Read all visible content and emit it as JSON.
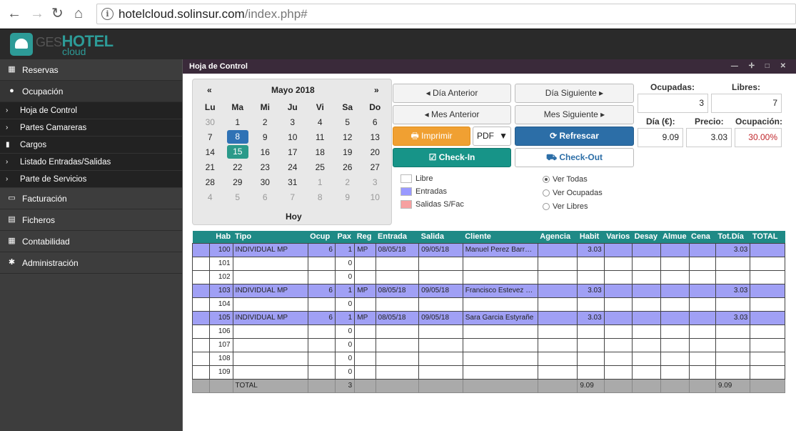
{
  "browser": {
    "url_host": "hotelcloud.solinsur.com",
    "url_path": "/index.php#"
  },
  "brand": {
    "ges": "GES",
    "hotel": "HOTEL",
    "cloud": "cloud"
  },
  "sidebar": {
    "items": [
      {
        "label": "Reservas",
        "icon": "calendar-icon"
      },
      {
        "label": "Ocupación",
        "icon": "circle-icon"
      }
    ],
    "subitems": [
      {
        "label": "Hoja de Control"
      },
      {
        "label": "Partes Camareras"
      },
      {
        "label": "Cargos"
      },
      {
        "label": "Listado Entradas/Salidas"
      },
      {
        "label": "Parte de Servicios"
      }
    ],
    "items2": [
      {
        "label": "Facturación",
        "icon": "card-icon"
      },
      {
        "label": "Ficheros",
        "icon": "archive-icon"
      },
      {
        "label": "Contabilidad",
        "icon": "calculator-icon"
      },
      {
        "label": "Administración",
        "icon": "gear-icon"
      }
    ]
  },
  "window": {
    "title": "Hoja de Control",
    "controls": "— ✛ □ ✕"
  },
  "calendar": {
    "prev": "«",
    "next": "»",
    "month": "Mayo 2018",
    "days": [
      "Lu",
      "Ma",
      "Mi",
      "Ju",
      "Vi",
      "Sa",
      "Do"
    ],
    "weeks": [
      [
        "30",
        "1",
        "2",
        "3",
        "4",
        "5",
        "6"
      ],
      [
        "7",
        "8",
        "9",
        "10",
        "11",
        "12",
        "13"
      ],
      [
        "14",
        "15",
        "16",
        "17",
        "18",
        "19",
        "20"
      ],
      [
        "21",
        "22",
        "23",
        "24",
        "25",
        "26",
        "27"
      ],
      [
        "28",
        "29",
        "30",
        "31",
        "1",
        "2",
        "3"
      ],
      [
        "4",
        "5",
        "6",
        "7",
        "8",
        "9",
        "10"
      ]
    ],
    "today_label": "Hoy"
  },
  "buttons": {
    "dia_anterior": "◂ Día Anterior",
    "dia_siguiente": "Día Siguiente ▸",
    "mes_anterior": "◂ Mes Anterior",
    "mes_siguiente": "Mes Siguiente ▸",
    "imprimir": "🖶 Imprimir",
    "formato": "PDF",
    "refrescar": "⟳ Refrescar",
    "checkin": "☑ Check-In",
    "checkout": "⛟ Check-Out"
  },
  "legend": [
    {
      "label": "Libre",
      "color": "#ffffff"
    },
    {
      "label": "Entradas",
      "color": "#9999ff"
    },
    {
      "label": "Salidas S/Fac",
      "color": "#f6a0a0"
    }
  ],
  "filters": [
    {
      "label": "Ver Todas",
      "checked": true
    },
    {
      "label": "Ver Ocupadas",
      "checked": false
    },
    {
      "label": "Ver Libres",
      "checked": false
    }
  ],
  "stats": {
    "ocupadas_label": "Ocupadas:",
    "ocupadas": "3",
    "libres_label": "Libres:",
    "libres": "7",
    "dia_label": "Día (€):",
    "dia": "9.09",
    "precio_label": "Precio:",
    "precio": "3.03",
    "ocupacion_label": "Ocupación:",
    "ocupacion": "30.00%"
  },
  "table": {
    "headers": [
      "",
      "Hab",
      "Tipo",
      "Ocup",
      "Pax",
      "Reg",
      "Entrada",
      "Salida",
      "Cliente",
      "Agencia",
      "Habit",
      "Varios",
      "Desay",
      "Almue",
      "Cena",
      "Tot.Día",
      "TOTAL"
    ],
    "rows": [
      [
        "",
        "100",
        "INDIVIDUAL MP",
        "6",
        "1",
        "MP",
        "08/05/18",
        "09/05/18",
        "Manuel Perez Barr…",
        "",
        "3.03",
        "",
        "",
        "",
        "",
        "3.03",
        ""
      ],
      [
        "",
        "101",
        "",
        "",
        "0",
        "",
        "",
        "",
        "",
        "",
        "",
        "",
        "",
        "",
        "",
        "",
        ""
      ],
      [
        "",
        "102",
        "",
        "",
        "0",
        "",
        "",
        "",
        "",
        "",
        "",
        "",
        "",
        "",
        "",
        "",
        ""
      ],
      [
        "",
        "103",
        "INDIVIDUAL MP",
        "6",
        "1",
        "MP",
        "08/05/18",
        "09/05/18",
        "Francisco Estevez …",
        "",
        "3.03",
        "",
        "",
        "",
        "",
        "3.03",
        ""
      ],
      [
        "",
        "104",
        "",
        "",
        "0",
        "",
        "",
        "",
        "",
        "",
        "",
        "",
        "",
        "",
        "",
        "",
        ""
      ],
      [
        "",
        "105",
        "INDIVIDUAL MP",
        "6",
        "1",
        "MP",
        "08/05/18",
        "09/05/18",
        "Sara Garcia Estyrañe",
        "",
        "3.03",
        "",
        "",
        "",
        "",
        "3.03",
        ""
      ],
      [
        "",
        "106",
        "",
        "",
        "0",
        "",
        "",
        "",
        "",
        "",
        "",
        "",
        "",
        "",
        "",
        "",
        ""
      ],
      [
        "",
        "107",
        "",
        "",
        "0",
        "",
        "",
        "",
        "",
        "",
        "",
        "",
        "",
        "",
        "",
        "",
        ""
      ],
      [
        "",
        "108",
        "",
        "",
        "0",
        "",
        "",
        "",
        "",
        "",
        "",
        "",
        "",
        "",
        "",
        "",
        ""
      ],
      [
        "",
        "109",
        "",
        "",
        "0",
        "",
        "",
        "",
        "",
        "",
        "",
        "",
        "",
        "",
        "",
        "",
        ""
      ]
    ],
    "total": [
      "",
      "",
      "TOTAL",
      "",
      "3",
      "",
      "",
      "",
      "",
      "",
      "9.09",
      "",
      "",
      "",
      "",
      "9.09",
      ""
    ],
    "occupied_rows": [
      0,
      3,
      5
    ]
  }
}
